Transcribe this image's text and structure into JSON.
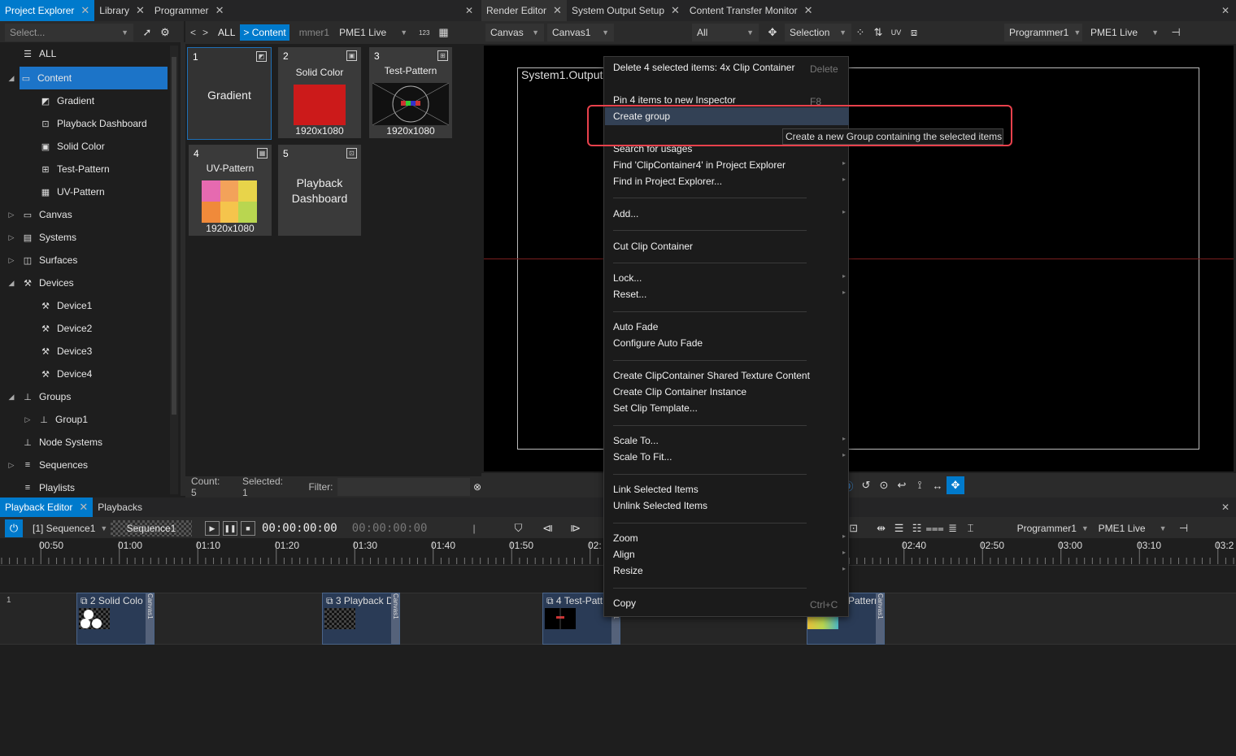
{
  "left_panel": {
    "tabs": [
      "Project Explorer",
      "Library",
      "Programmer"
    ],
    "select_placeholder": "Select...",
    "tree": [
      {
        "label": "ALL",
        "icon": "all-icon",
        "arrow": ""
      },
      {
        "label": "Content",
        "icon": "content-icon",
        "arrow": "◢",
        "selected": true
      },
      {
        "label": "Gradient",
        "icon": "gradient-icon",
        "arrow": ""
      },
      {
        "label": "Playback Dashboard",
        "icon": "dashboard-icon",
        "arrow": ""
      },
      {
        "label": "Solid Color",
        "icon": "solid-color-icon",
        "arrow": ""
      },
      {
        "label": "Test-Pattern",
        "icon": "test-pattern-icon",
        "arrow": ""
      },
      {
        "label": "UV-Pattern",
        "icon": "uv-pattern-icon",
        "arrow": ""
      },
      {
        "label": "Canvas",
        "icon": "canvas-icon",
        "arrow": "▷"
      },
      {
        "label": "Systems",
        "icon": "systems-icon",
        "arrow": "▷"
      },
      {
        "label": "Surfaces",
        "icon": "surfaces-icon",
        "arrow": "▷"
      },
      {
        "label": "Devices",
        "icon": "devices-icon",
        "arrow": "◢"
      },
      {
        "label": "Device1",
        "icon": "device-icon",
        "arrow": ""
      },
      {
        "label": "Device2",
        "icon": "device-icon",
        "arrow": ""
      },
      {
        "label": "Device3",
        "icon": "device-icon",
        "arrow": ""
      },
      {
        "label": "Device4",
        "icon": "device-icon",
        "arrow": ""
      },
      {
        "label": "Groups",
        "icon": "groups-icon",
        "arrow": "◢"
      },
      {
        "label": "Group1",
        "icon": "group-icon",
        "arrow": "▷"
      },
      {
        "label": "Node Systems",
        "icon": "node-systems-icon",
        "arrow": ""
      },
      {
        "label": "Sequences",
        "icon": "sequences-icon",
        "arrow": "▷"
      },
      {
        "label": "Playlists",
        "icon": "playlists-icon",
        "arrow": ""
      }
    ]
  },
  "content_panel": {
    "nav_prev": "<",
    "nav_next": ">",
    "all_label": "ALL",
    "crumb": "> Content",
    "programmer": "mmer1",
    "live": "PME1 Live",
    "num_label": "123",
    "tiles": [
      {
        "num": "1",
        "title": "Gradient",
        "res": ""
      },
      {
        "num": "2",
        "title": "Solid Color",
        "res": "1920x1080"
      },
      {
        "num": "3",
        "title": "Test-Pattern",
        "res": "1920x1080"
      },
      {
        "num": "4",
        "title": "UV-Pattern",
        "res": "1920x1080"
      },
      {
        "num": "5",
        "title": "Playback Dashboard",
        "res": ""
      }
    ],
    "count": "Count:  5",
    "selected": "Selected:  1",
    "filter": "Filter:"
  },
  "render_editor": {
    "tabs": [
      "Render Editor",
      "System Output Setup",
      "Content Transfer Monitor"
    ],
    "canvas": "Canvas",
    "canvas1": "Canvas1",
    "all": "All",
    "selection": "Selection",
    "uv": "UV",
    "programmer": "Programmer1",
    "live": "PME1 Live",
    "output_label": "System1.Output1"
  },
  "context_menu": {
    "items": [
      {
        "label": "Delete 4 selected items: 4x Clip Container",
        "shortcut": "Delete",
        "sub": false
      },
      {
        "label": "Pin 4 items to new Inspector",
        "shortcut": "F8",
        "sub": false
      },
      {
        "label": "Create group",
        "shortcut": "",
        "sub": false
      },
      {
        "label": "Search for usages",
        "shortcut": "",
        "sub": false
      },
      {
        "label": "Find 'ClipContainer4' in Project Explorer",
        "shortcut": "",
        "sub": true
      },
      {
        "label": "Find in Project Explorer...",
        "shortcut": "",
        "sub": true
      },
      {
        "label": "Add...",
        "shortcut": "",
        "sub": true
      },
      {
        "label": "Cut Clip Container",
        "shortcut": "",
        "sub": false
      },
      {
        "label": "Lock...",
        "shortcut": "",
        "sub": true
      },
      {
        "label": "Reset...",
        "shortcut": "",
        "sub": true
      },
      {
        "label": "Auto Fade",
        "shortcut": "",
        "sub": false
      },
      {
        "label": "Configure Auto Fade",
        "shortcut": "",
        "sub": false
      },
      {
        "label": "Create ClipContainer Shared Texture Content",
        "shortcut": "",
        "sub": false
      },
      {
        "label": "Create Clip Container Instance",
        "shortcut": "",
        "sub": false
      },
      {
        "label": "Set Clip Template...",
        "shortcut": "",
        "sub": false
      },
      {
        "label": "Scale To...",
        "shortcut": "",
        "sub": true
      },
      {
        "label": "Scale To Fit...",
        "shortcut": "",
        "sub": true
      },
      {
        "label": "Link Selected Items",
        "shortcut": "",
        "sub": false
      },
      {
        "label": "Unlink Selected Items",
        "shortcut": "",
        "sub": false
      },
      {
        "label": "Zoom",
        "shortcut": "",
        "sub": true
      },
      {
        "label": "Align",
        "shortcut": "",
        "sub": true
      },
      {
        "label": "Resize",
        "shortcut": "",
        "sub": true
      },
      {
        "label": "Copy",
        "shortcut": "Ctrl+C",
        "sub": false
      }
    ],
    "tooltip": "Create a new Group containing the selected items"
  },
  "playback": {
    "tabs": [
      "Playback Editor",
      "Playbacks"
    ],
    "sequence_select": "[1] Sequence1",
    "sequence_name": "Sequence1",
    "time_current": "00:00:00:00",
    "time_total": "00:00:00:00",
    "programmer": "Programmer1",
    "live": "PME1 Live",
    "ruler": [
      "00:50",
      "01:00",
      "01:10",
      "01:20",
      "01:30",
      "01:40",
      "01:50",
      "02:",
      "02:40",
      "02:50",
      "03:00",
      "03:10",
      "03:2"
    ],
    "layer": "1",
    "clips": [
      "2 Solid Colo",
      "3 Playback D",
      "4 Test-Patt",
      "Pattern"
    ],
    "clip_canvas": "Canvas1"
  },
  "colors": {
    "accent": "#007acc",
    "highlight": "#e8414c",
    "solid": "#cc1a1a"
  }
}
